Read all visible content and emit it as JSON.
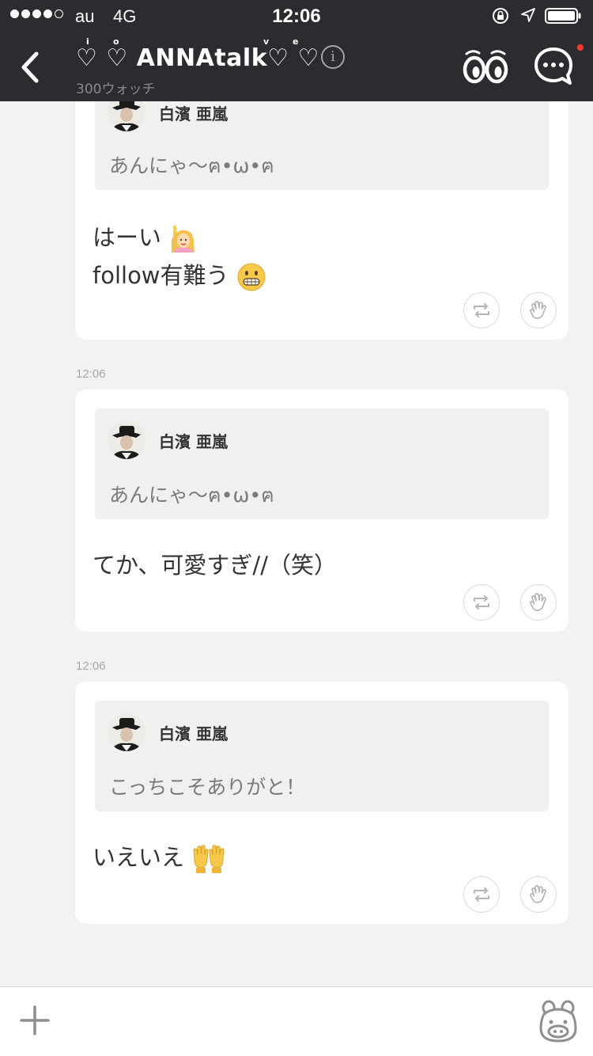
{
  "status_bar": {
    "carrier": "au",
    "network": "4G",
    "time": "12:06"
  },
  "header": {
    "title": "♡ ♡ ANNAtalk♡ ♡",
    "title_superscripts": [
      "i",
      "o",
      "v",
      "e"
    ],
    "subtitle": "300ウォッチ",
    "info_glyph": "i",
    "icons": {
      "back": "back-arrow-icon",
      "info": "info-icon",
      "watch": "eyes-watch-icon",
      "chat": "chat-bubble-icon"
    },
    "has_notification": true
  },
  "feed": {
    "posts": [
      {
        "timestamp": "",
        "quote_author": "白濱 亜嵐",
        "quote_text": "あんにゃ〜ฅ•ω•ฅ",
        "message_lines": [
          "はーい",
          "follow有難う"
        ],
        "message_emojis": [
          "raising-hand-emoji",
          "grinning-face-emoji"
        ]
      },
      {
        "timestamp": "12:06",
        "quote_author": "白濱 亜嵐",
        "quote_text": "あんにゃ〜ฅ•ω•ฅ",
        "message_lines": [
          "てか、可愛すぎ//（笑）"
        ],
        "message_emojis": []
      },
      {
        "timestamp": "12:06",
        "quote_author": "白濱 亜嵐",
        "quote_text": "こっちこそありがと！",
        "message_lines": [
          "いえいえ"
        ],
        "message_emojis": [
          "raising-both-hands-emoji"
        ]
      }
    ],
    "action_icons": [
      "repost-icon",
      "clap-hand-icon"
    ]
  },
  "bottom_bar": {
    "icons": [
      "plus-icon",
      "bear-stamp-icon"
    ]
  },
  "colors": {
    "header_bg": "#2b2c2f",
    "feed_bg": "#f2f2f2",
    "card_bg": "#ffffff",
    "quote_bg": "#f0f0f0",
    "notification": "#ff3b30"
  }
}
